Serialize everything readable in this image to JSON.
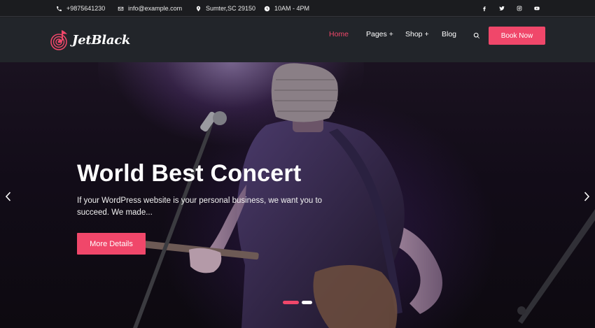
{
  "topbar": {
    "phone": "+9875641230",
    "email": "info@example.com",
    "address": "Sumter,SC 29150",
    "hours": "10AM - 4PM",
    "social": [
      "facebook-icon",
      "twitter-icon",
      "instagram-icon",
      "youtube-icon"
    ]
  },
  "header": {
    "logo_text": "JetBlack",
    "nav": [
      "Home",
      "Pages +",
      "Shop +",
      "Blog"
    ],
    "active_nav": "Home",
    "book_label": "Book Now"
  },
  "hero": {
    "title": "World Best Concert",
    "text": "If your WordPress website is your personal business, we want you to succeed. We made...",
    "button_label": "More Details",
    "slides": 2,
    "active_slide": 1
  },
  "colors": {
    "accent": "#f0476a",
    "topbar_bg": "#1b1c1f",
    "header_bg": "#22252a"
  }
}
